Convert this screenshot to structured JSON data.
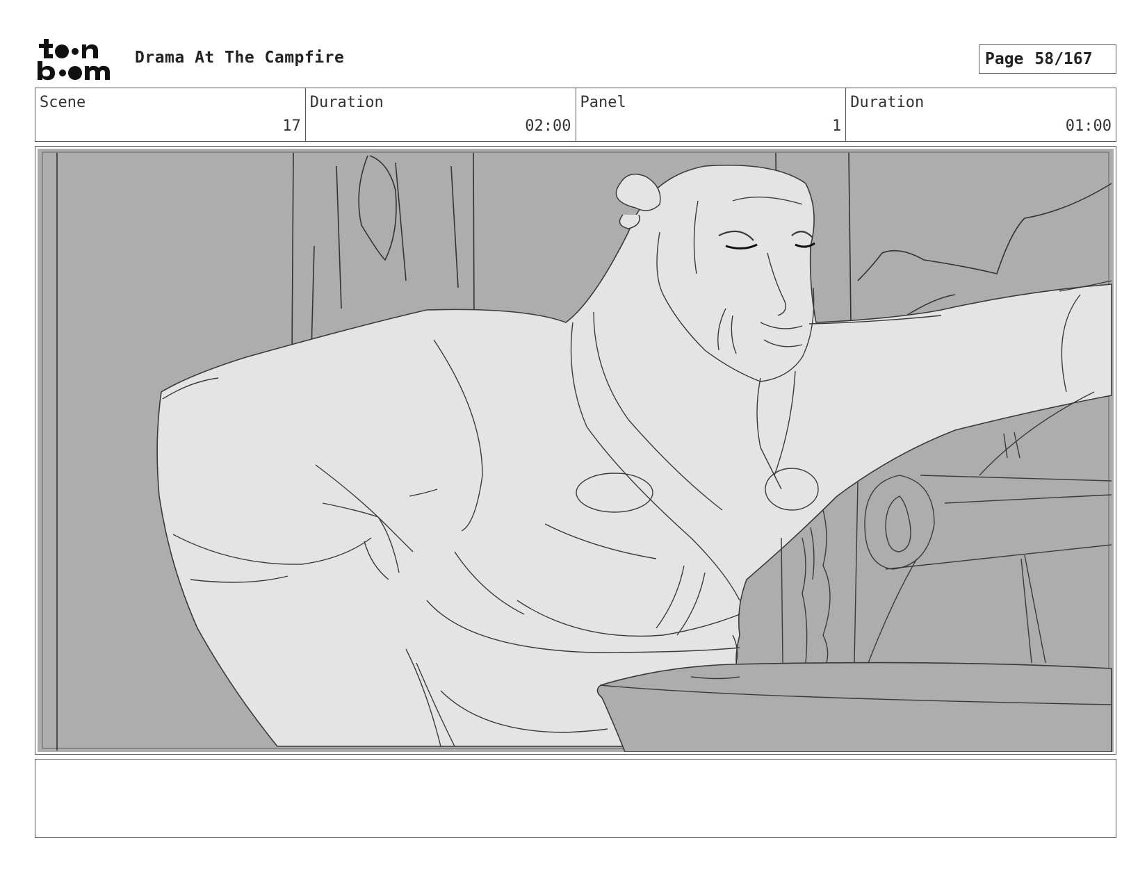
{
  "header": {
    "logo_text": "toon boom",
    "title": "Drama At The Campfire",
    "page_label": "Page",
    "page_value": "58/167"
  },
  "info": {
    "scene_label": "Scene",
    "scene_value": "17",
    "scene_duration_label": "Duration",
    "scene_duration_value": "02:00",
    "panel_label": "Panel",
    "panel_value": "1",
    "panel_duration_label": "Duration",
    "panel_duration_value": "01:00"
  },
  "panel": {
    "image_icon": "storyboard-sketch-image",
    "colors": {
      "background": "#adadad",
      "figure": "#e4e4e4",
      "line": "#3a3a3a"
    }
  },
  "notes": {
    "text": ""
  }
}
